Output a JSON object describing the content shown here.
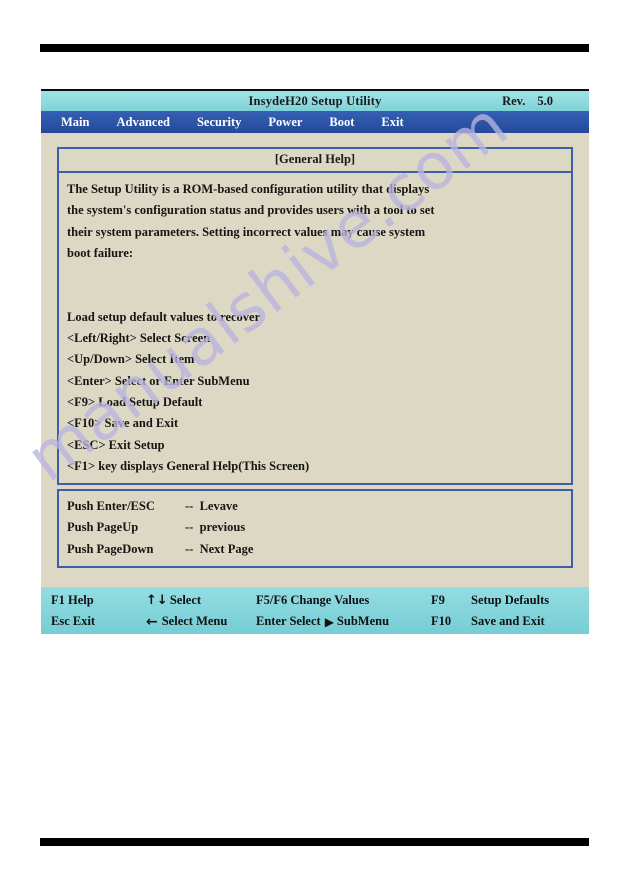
{
  "page": {
    "watermark": "manualshive.com",
    "watermark_color": "#b9b4e0",
    "rule_color": "#000000"
  },
  "bios": {
    "title": "InsydeH20 Setup Utility",
    "rev_label": "Rev.",
    "rev_value": "5.0",
    "titlebar_color": "#8fdbe0",
    "menubar_color": "#2b52a6",
    "screen_bg_color": "#ddd8c4",
    "panel_border_color": "#3c5fa8",
    "menu": [
      {
        "label": "Main"
      },
      {
        "label": "Advanced"
      },
      {
        "label": "Security"
      },
      {
        "label": "Power"
      },
      {
        "label": "Boot"
      },
      {
        "label": "Exit"
      }
    ],
    "help_panel": {
      "header": "[General Help]",
      "lines": [
        "The Setup Utility is a ROM-based configuration utility that displays",
        "the system's configuration status and provides users with a tool to set",
        "their system parameters. Setting incorrect values may cause system",
        "boot failure:",
        "",
        "",
        "Load setup default values to recover",
        "<Left/Right> Select Screen",
        "<Up/Down> Select Item",
        "<Enter> Select or Enter SubMenu",
        "<F9> Load Setup Default",
        "<F10> Save and Exit",
        "<ESC> Exit Setup",
        "<F1> key displays General Help(This Screen)"
      ]
    },
    "push_panel": {
      "rows": [
        {
          "key": "Push Enter/ESC",
          "desc": "--  Levave"
        },
        {
          "key": "Push PageUp",
          "desc": "--  previous"
        },
        {
          "key": "Push PageDown",
          "desc": "--  Next Page"
        }
      ]
    },
    "footer": {
      "row1": {
        "help": "F1 Help",
        "select": "Select",
        "change_values": "F5/F6 Change Values",
        "f9_key": "F9",
        "setup_defaults": "Setup Defaults",
        "up_glyph": "↑",
        "down_glyph": "↓"
      },
      "row2": {
        "exit": "Esc Exit",
        "select_menu": "Select Menu",
        "enter_select": "Enter Select",
        "submenu": "SubMenu",
        "f10_key": "F10",
        "save_and_exit": "Save and Exit",
        "left_glyph": "←",
        "right_glyph": "▶"
      }
    }
  }
}
